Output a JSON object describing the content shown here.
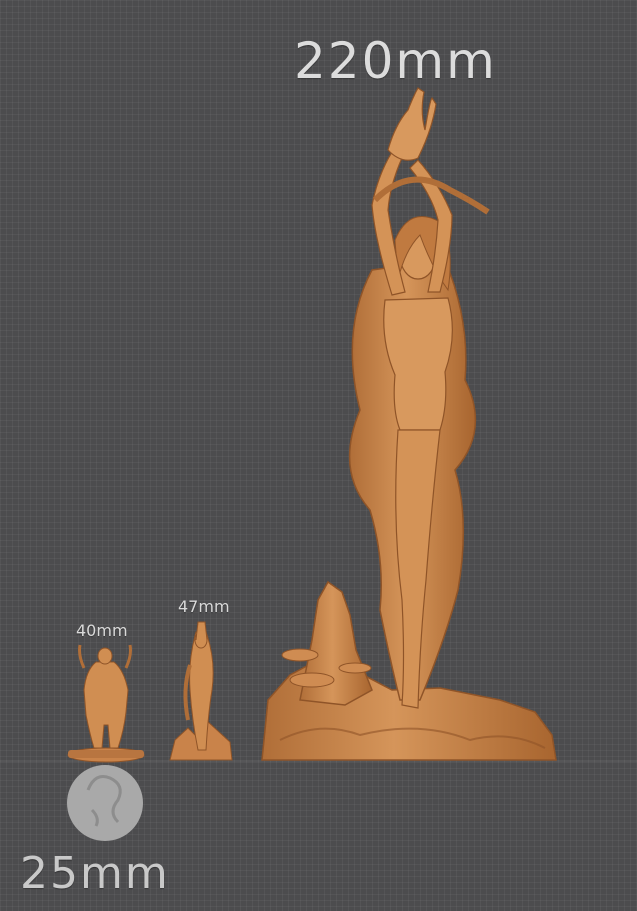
{
  "labels": {
    "large": "220mm",
    "medium": "47mm",
    "small": "40mm",
    "base": "25mm"
  },
  "colors": {
    "background": "#4c4c4e",
    "miniature": "#c9834a",
    "miniature_shadow": "#8f5428",
    "base_disc": "#a9a9a9",
    "label_text": "#d9d9d9"
  }
}
